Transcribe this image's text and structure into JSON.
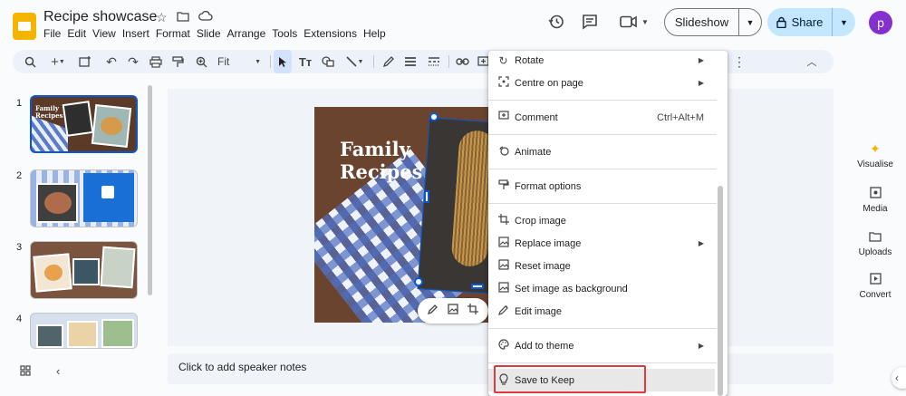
{
  "header": {
    "doc_title": "Recipe showcase",
    "menus": [
      "File",
      "Edit",
      "View",
      "Insert",
      "Format",
      "Slide",
      "Arrange",
      "Tools",
      "Extensions",
      "Help"
    ],
    "slideshow_label": "Slideshow",
    "share_label": "Share",
    "avatar_letter": "p"
  },
  "toolbar": {
    "zoom_label": "Fit"
  },
  "filmstrip": {
    "slide_numbers": [
      "1",
      "2",
      "3",
      "4"
    ],
    "thumb1_title": "Family Recipes"
  },
  "slide": {
    "title_line1": "Family",
    "title_line2": "Recipes"
  },
  "notes": {
    "placeholder": "Click to add speaker notes"
  },
  "side_panel": {
    "visualise": "Visualise",
    "media": "Media",
    "uploads": "Uploads",
    "convert": "Convert"
  },
  "context_menu": {
    "rotate": "Rotate",
    "centre_on_page": "Centre on page",
    "comment": "Comment",
    "comment_shortcut": "Ctrl+Alt+M",
    "animate": "Animate",
    "format_options": "Format options",
    "crop_image": "Crop image",
    "replace_image": "Replace image",
    "reset_image": "Reset image",
    "set_as_background": "Set image as background",
    "edit_image": "Edit image",
    "add_to_theme": "Add to theme",
    "save_to_keep": "Save to Keep"
  },
  "colors": {
    "accent": "#0b57d0",
    "share_bg": "#c2e7ff",
    "highlight_box": "#e2383f",
    "avatar": "#8430ce",
    "slides_logo": "#f4b400"
  }
}
